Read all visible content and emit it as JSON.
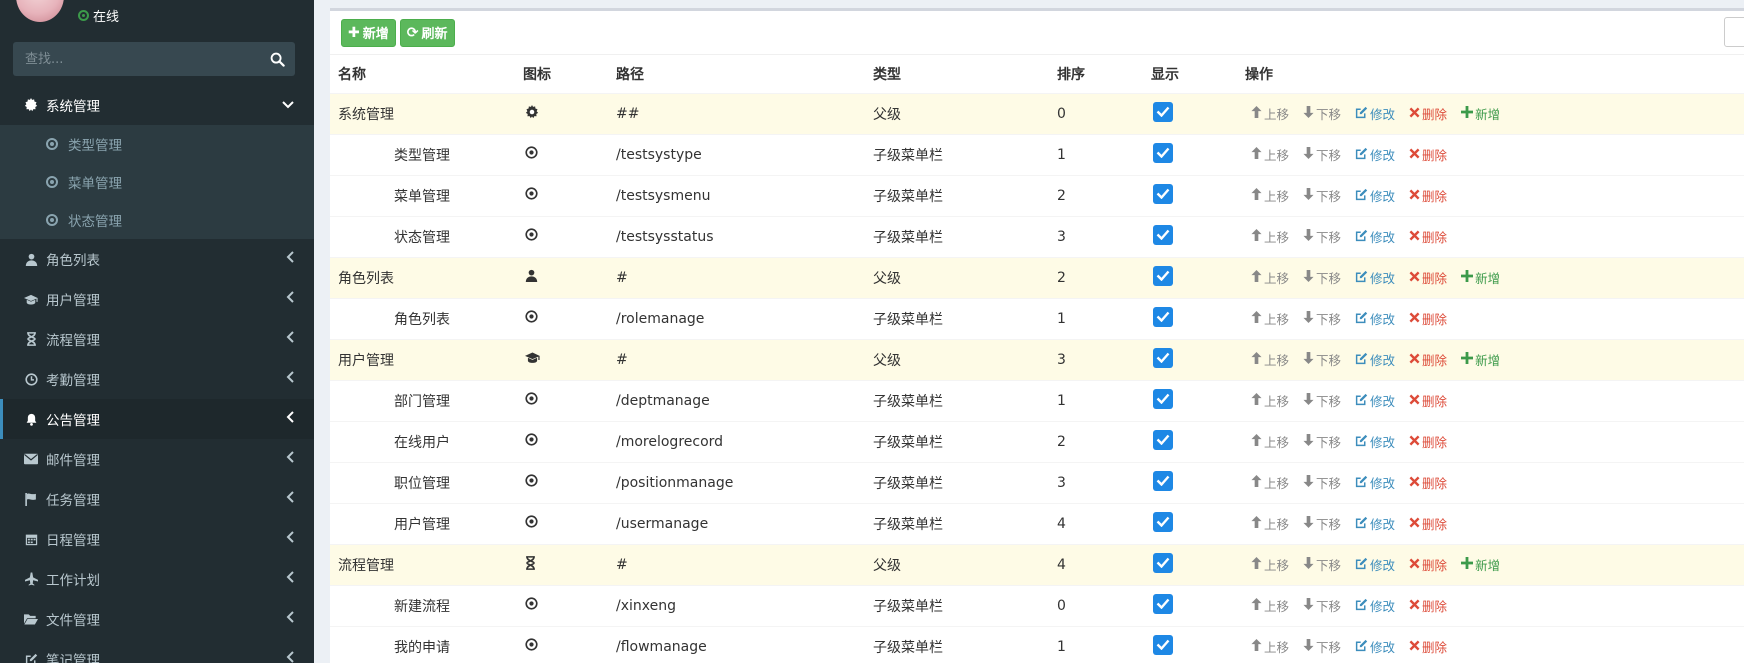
{
  "sidebar": {
    "status_label": "在线",
    "search_placeholder": "查找...",
    "menu": [
      {
        "label": "系统管理",
        "icon": "gear-icon",
        "open": true,
        "children": [
          {
            "label": "类型管理"
          },
          {
            "label": "菜单管理"
          },
          {
            "label": "状态管理"
          }
        ]
      },
      {
        "label": "角色列表",
        "icon": "user-icon"
      },
      {
        "label": "用户管理",
        "icon": "graduation-cap-icon"
      },
      {
        "label": "流程管理",
        "icon": "hourglass-icon"
      },
      {
        "label": "考勤管理",
        "icon": "clock-icon"
      },
      {
        "label": "公告管理",
        "icon": "bell-icon",
        "active": true
      },
      {
        "label": "邮件管理",
        "icon": "envelope-icon"
      },
      {
        "label": "任务管理",
        "icon": "flag-icon"
      },
      {
        "label": "日程管理",
        "icon": "calendar-icon"
      },
      {
        "label": "工作计划",
        "icon": "plane-icon"
      },
      {
        "label": "文件管理",
        "icon": "folder-open-icon"
      },
      {
        "label": "笔记管理",
        "icon": "edit-icon"
      }
    ]
  },
  "toolbar": {
    "add_label": "新增",
    "refresh_label": "刷新"
  },
  "table": {
    "headers": {
      "name": "名称",
      "icon": "图标",
      "path": "路径",
      "type": "类型",
      "sort": "排序",
      "show": "显示",
      "ops": "操作"
    },
    "op_labels": {
      "up": "上移",
      "down": "下移",
      "edit": "修改",
      "delete": "删除",
      "add": "新增"
    },
    "rows": [
      {
        "name": "系统管理",
        "icon": "gear-icon",
        "path": "##",
        "type": "父级",
        "sort": "0",
        "parent": true,
        "show": true
      },
      {
        "name": "类型管理",
        "icon": "dot-circle-icon",
        "path": "/testsystype",
        "type": "子级菜单栏",
        "sort": "1",
        "parent": false,
        "show": true
      },
      {
        "name": "菜单管理",
        "icon": "dot-circle-icon",
        "path": "/testsysmenu",
        "type": "子级菜单栏",
        "sort": "2",
        "parent": false,
        "show": true
      },
      {
        "name": "状态管理",
        "icon": "dot-circle-icon",
        "path": "/testsysstatus",
        "type": "子级菜单栏",
        "sort": "3",
        "parent": false,
        "show": true
      },
      {
        "name": "角色列表",
        "icon": "user-icon",
        "path": "#",
        "type": "父级",
        "sort": "2",
        "parent": true,
        "show": true
      },
      {
        "name": "角色列表",
        "icon": "dot-circle-icon",
        "path": "/rolemanage",
        "type": "子级菜单栏",
        "sort": "1",
        "parent": false,
        "show": true
      },
      {
        "name": "用户管理",
        "icon": "graduation-cap-icon",
        "path": "#",
        "type": "父级",
        "sort": "3",
        "parent": true,
        "show": true
      },
      {
        "name": "部门管理",
        "icon": "dot-circle-icon",
        "path": "/deptmanage",
        "type": "子级菜单栏",
        "sort": "1",
        "parent": false,
        "show": true
      },
      {
        "name": "在线用户",
        "icon": "dot-circle-icon",
        "path": "/morelogrecord",
        "type": "子级菜单栏",
        "sort": "2",
        "parent": false,
        "show": true
      },
      {
        "name": "职位管理",
        "icon": "dot-circle-icon",
        "path": "/positionmanage",
        "type": "子级菜单栏",
        "sort": "3",
        "parent": false,
        "show": true
      },
      {
        "name": "用户管理",
        "icon": "dot-circle-icon",
        "path": "/usermanage",
        "type": "子级菜单栏",
        "sort": "4",
        "parent": false,
        "show": true
      },
      {
        "name": "流程管理",
        "icon": "hourglass-icon",
        "path": "#",
        "type": "父级",
        "sort": "4",
        "parent": true,
        "show": true
      },
      {
        "name": "新建流程",
        "icon": "dot-circle-icon",
        "path": "/xinxeng",
        "type": "子级菜单栏",
        "sort": "0",
        "parent": false,
        "show": true
      },
      {
        "name": "我的申请",
        "icon": "dot-circle-icon",
        "path": "/flowmanage",
        "type": "子级菜单栏",
        "sort": "1",
        "parent": false,
        "show": true
      }
    ]
  }
}
